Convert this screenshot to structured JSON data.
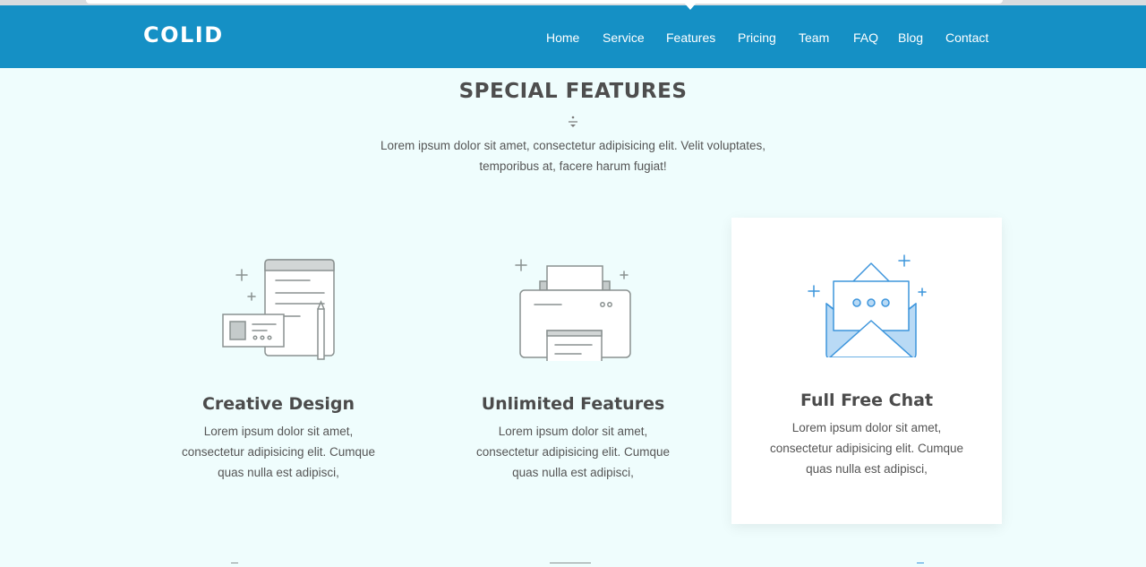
{
  "navbar": {
    "logo": "COLID",
    "items": [
      {
        "label": "Home"
      },
      {
        "label": "Service"
      },
      {
        "label": "Features"
      },
      {
        "label": "Pricing"
      },
      {
        "label": "Team"
      },
      {
        "label": "FAQ"
      },
      {
        "label": "Blog"
      },
      {
        "label": "Contact"
      }
    ],
    "active_item": "Features"
  },
  "section": {
    "title": "SPECIAL FEATURES",
    "description_line1": "Lorem ipsum dolor sit amet, consectetur adipisicing elit. Velit voluptates,",
    "description_line2": "temporibus at, facere harum fugiat!"
  },
  "features": [
    {
      "title": "Creative Design",
      "icon": "design-document-icon",
      "text_line1": "Lorem ipsum dolor sit amet,",
      "text_line2": "consectetur adipisicing elit. Cumque",
      "text_line3": "quas nulla est adipisci,"
    },
    {
      "title": "Unlimited Features",
      "icon": "printer-icon",
      "text_line1": "Lorem ipsum dolor sit amet,",
      "text_line2": "consectetur adipisicing elit. Cumque",
      "text_line3": "quas nulla est adipisci,"
    },
    {
      "title": "Full Free Chat",
      "icon": "chat-envelope-icon",
      "text_line1": "Lorem ipsum dolor sit amet,",
      "text_line2": "consectetur adipisicing elit. Cumque",
      "text_line3": "quas nulla est adipisci,"
    }
  ],
  "colors": {
    "brand": "#1590c5",
    "background": "#effdfd",
    "icon_gray": "#8a9190",
    "icon_blue": "#3d95dc"
  }
}
